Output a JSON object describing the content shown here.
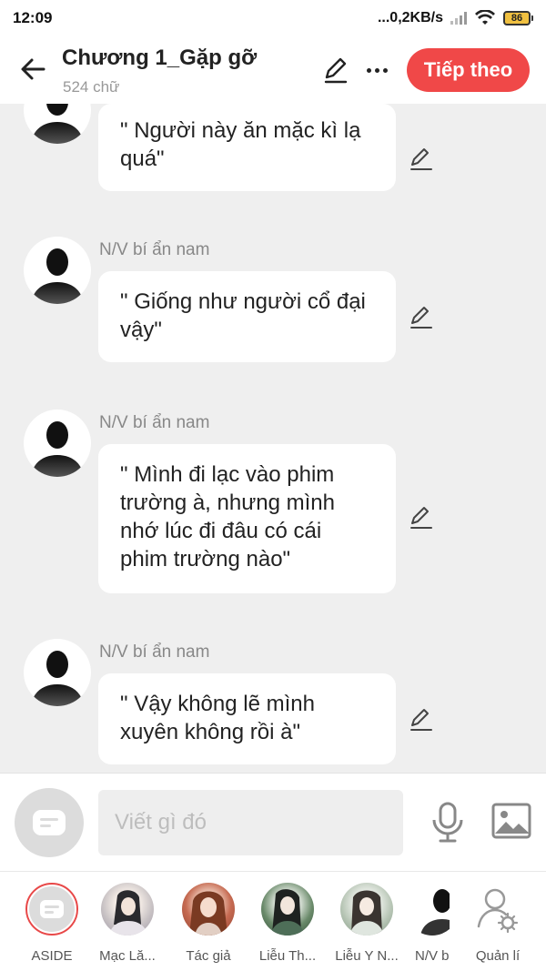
{
  "status_bar": {
    "time": "12:09",
    "net_speed": "...0,2KB/s",
    "battery": "86"
  },
  "header": {
    "title": "Chương 1_Gặp gỡ",
    "word_count": "524 chữ",
    "next_label": "Tiếp theo"
  },
  "messages": [
    {
      "sender": "",
      "text": "\" Người này ăn mặc kì lạ quá\""
    },
    {
      "sender": "N/V bí ẩn nam",
      "text": "\" Giống như người cổ đại vậy\""
    },
    {
      "sender": "N/V bí ẩn nam",
      "text": "\" Mình đi lạc vào phim trường à, nhưng mình nhớ lúc đi đâu có cái phim trường nào\""
    },
    {
      "sender": "N/V bí ẩn nam",
      "text": "\" Vậy không lẽ mình xuyên không rồi à\""
    }
  ],
  "composer": {
    "placeholder": "Viết gì đó"
  },
  "characters": [
    {
      "label": "ASIDE"
    },
    {
      "label": "Mạc Lă..."
    },
    {
      "label": "Tác giả"
    },
    {
      "label": "Liễu Th..."
    },
    {
      "label": "Liễu Y N..."
    },
    {
      "label": "N/V bí"
    },
    {
      "label": "Quản lí"
    }
  ],
  "colors": {
    "accent": "#f04848",
    "background": "#efefef"
  }
}
